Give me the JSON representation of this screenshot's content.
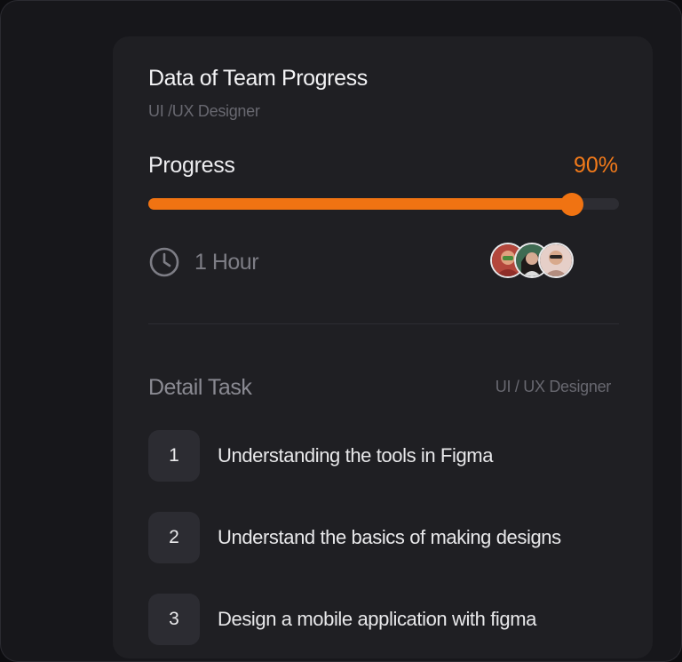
{
  "card": {
    "title": "Data of Team Progress",
    "subtitle": "UI /UX Designer"
  },
  "progress": {
    "label": "Progress",
    "value_text": "90%",
    "fraction": 0.9,
    "accent_color": "#f07312"
  },
  "meta": {
    "clock_icon": "clock-icon",
    "duration": "1 Hour",
    "avatar_count": 3
  },
  "detail": {
    "title": "Detail Task",
    "role": "UI / UX Designer",
    "tasks": [
      {
        "number": "1",
        "text": "Understanding the tools in Figma"
      },
      {
        "number": "2",
        "text": "Understand the basics of making designs"
      },
      {
        "number": "3",
        "text": "Design a mobile application with figma"
      }
    ]
  }
}
